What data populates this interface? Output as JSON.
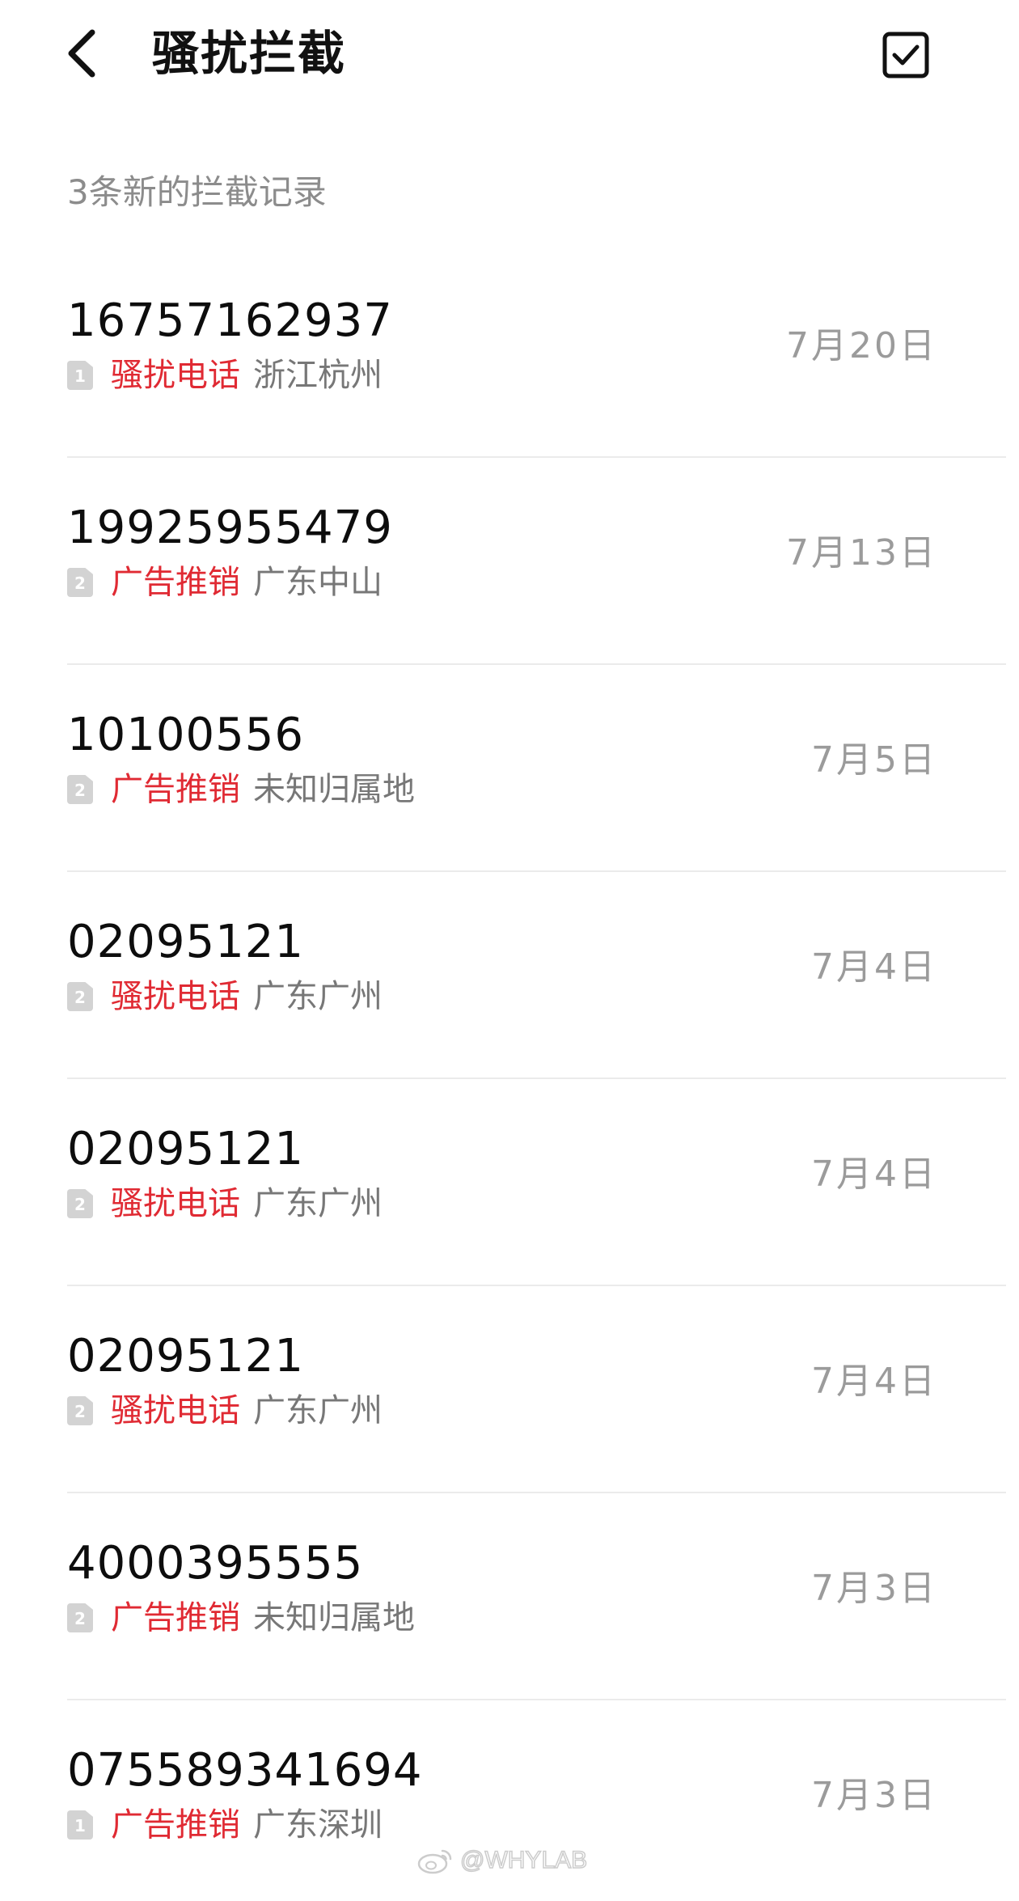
{
  "header": {
    "title": "骚扰拦截",
    "back_icon": "chevron-left-icon",
    "select_icon": "checkbox-checked-icon"
  },
  "subtitle": "3条新的拦截记录",
  "colors": {
    "tag_red": "#e02a33",
    "number": "#0d0d0d",
    "secondary": "#777777",
    "date": "#9b9b9b"
  },
  "records": [
    {
      "number": "16757162937",
      "sim": "1",
      "tag": "骚扰电话",
      "location": "浙江杭州",
      "date": "7月20日"
    },
    {
      "number": "19925955479",
      "sim": "2",
      "tag": "广告推销",
      "location": "广东中山",
      "date": "7月13日"
    },
    {
      "number": "10100556",
      "sim": "2",
      "tag": "广告推销",
      "location": "未知归属地",
      "date": "7月5日"
    },
    {
      "number": "02095121",
      "sim": "2",
      "tag": "骚扰电话",
      "location": "广东广州",
      "date": "7月4日"
    },
    {
      "number": "02095121",
      "sim": "2",
      "tag": "骚扰电话",
      "location": "广东广州",
      "date": "7月4日"
    },
    {
      "number": "02095121",
      "sim": "2",
      "tag": "骚扰电话",
      "location": "广东广州",
      "date": "7月4日"
    },
    {
      "number": "4000395555",
      "sim": "2",
      "tag": "广告推销",
      "location": "未知归属地",
      "date": "7月3日"
    },
    {
      "number": "075589341694",
      "sim": "1",
      "tag": "广告推销",
      "location": "广东深圳",
      "date": "7月3日"
    }
  ],
  "watermark": {
    "icon": "weibo-icon",
    "text": "@WHYLAB"
  }
}
